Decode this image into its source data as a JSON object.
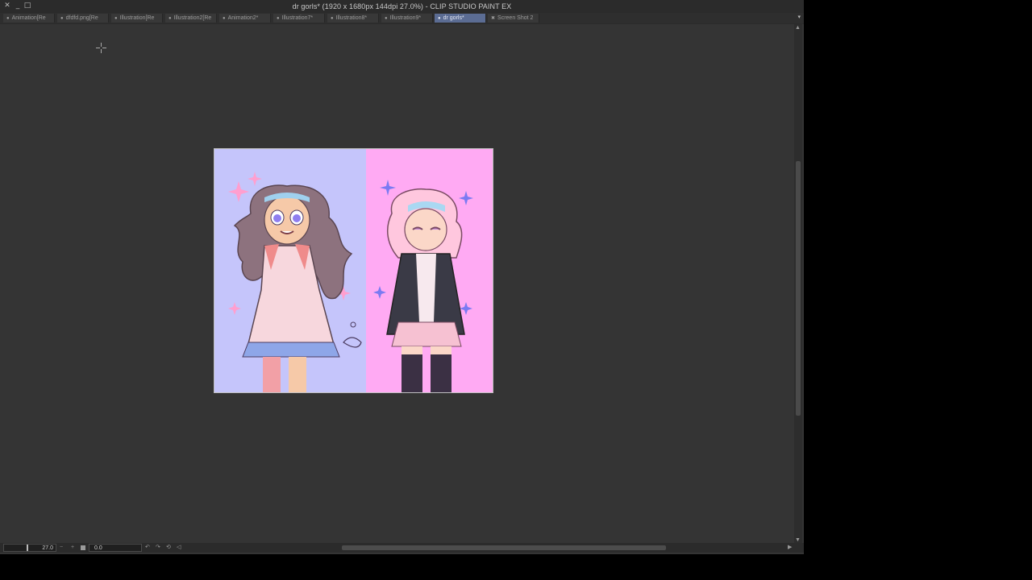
{
  "window": {
    "title": "dr gorls* (1920 x 1680px 144dpi 27.0%)  - CLIP STUDIO PAINT EX",
    "controls": {
      "close": "✕",
      "minimize": "_",
      "maximize": "□"
    }
  },
  "tabs": [
    {
      "label": "Animation[Re",
      "active": false
    },
    {
      "label": "dfdfd.png[Re",
      "active": false
    },
    {
      "label": "Illustration[Re",
      "active": false
    },
    {
      "label": "Illustration2[Re",
      "active": false
    },
    {
      "label": "Animation2*",
      "active": false
    },
    {
      "label": "Illustration7*",
      "active": false
    },
    {
      "label": "Illustration8*",
      "active": false
    },
    {
      "label": "Illustration9*",
      "active": false
    },
    {
      "label": "dr gorls*",
      "active": true
    },
    {
      "label": "Screen Shot 2",
      "active": false
    }
  ],
  "tab_menu_icon": "▾",
  "status": {
    "zoom_value": "27.0",
    "rotate_value": "0.0",
    "zoom_out_icon": "−",
    "zoom_in_icon": "+",
    "rotate_left_icon": "↶",
    "rotate_right_icon": "↷",
    "rotate_reset_icon": "⟲",
    "flip_icon": "◁"
  },
  "colors": {
    "workspace": "#343434",
    "artwork_left_bg": "#c5c5fb",
    "artwork_right_bg": "#ffaaf3",
    "active_tab": "#5b6c93"
  }
}
